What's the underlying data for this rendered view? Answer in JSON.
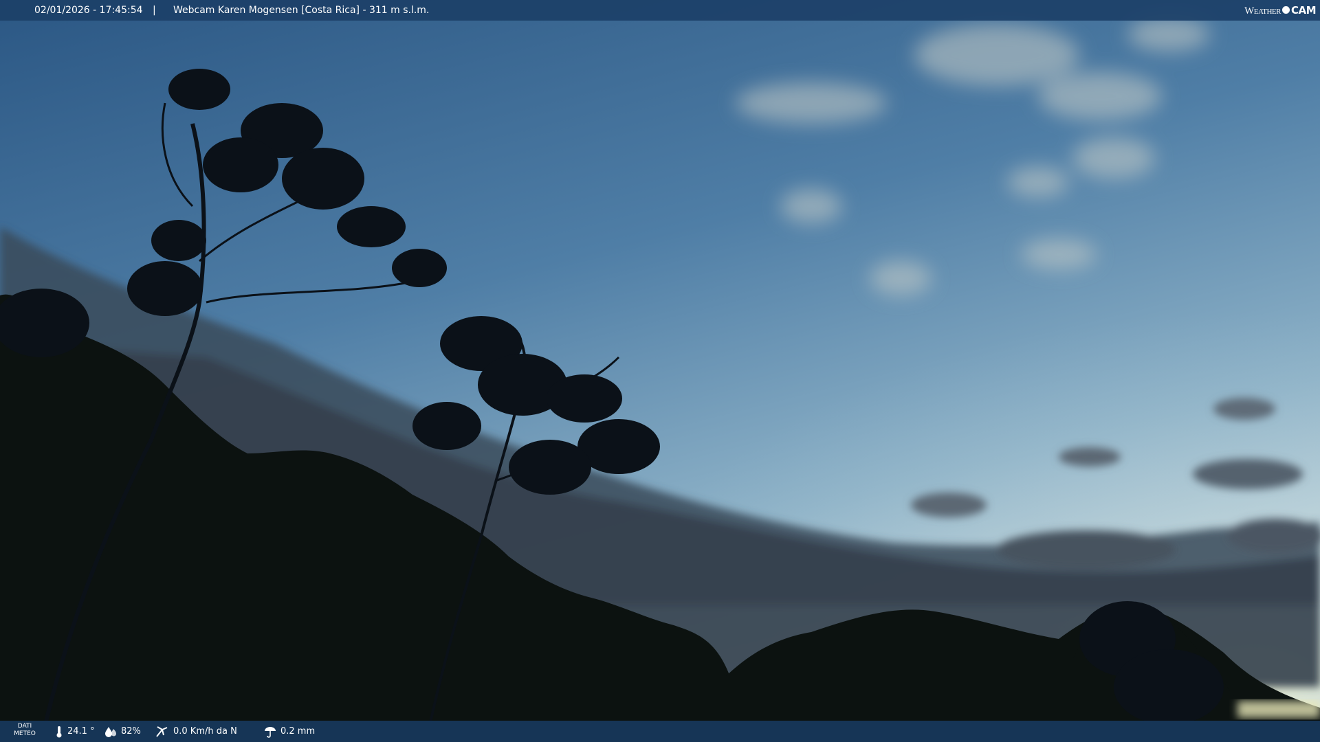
{
  "header": {
    "timestamp": "02/01/2026 - 17:45:54",
    "separator": "|",
    "title": "Webcam Karen Mogensen [Costa Rica]  - 311 m s.l.m.",
    "logo_word": "Weather",
    "logo_cam": "CAM"
  },
  "footer": {
    "dati_line1": "DATI",
    "dati_line2": "METEO",
    "temperature": "24.1 °",
    "humidity": "82%",
    "wind": "0.0 Km/h da N",
    "rain": "0.2 mm"
  },
  "icons": [
    "thermometer-icon",
    "humidity-icon",
    "wind-icon",
    "rain-icon"
  ],
  "colors": {
    "bar": "#1c4068",
    "sky_top": "#2f5a86",
    "sky_horizon": "#b9d0dc"
  }
}
